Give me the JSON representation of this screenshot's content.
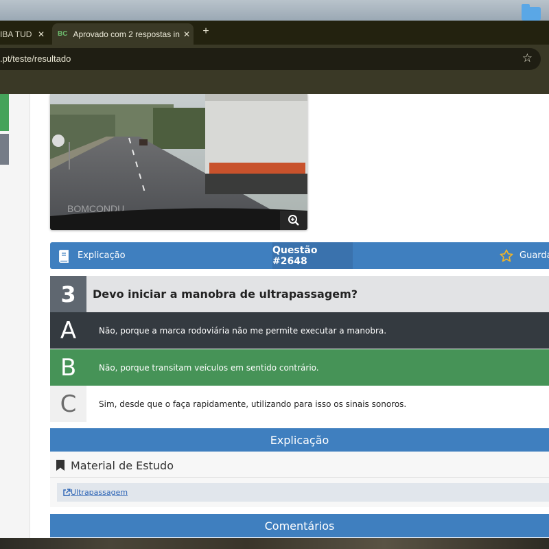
{
  "browser": {
    "tabs": [
      {
        "title": "IBA TUD",
        "active": false
      },
      {
        "title": "Aprovado com 2 respostas in",
        "favicon": "BC",
        "active": true
      }
    ],
    "url": ".pt/teste/resultado"
  },
  "question": {
    "image_watermark": "BOMCONDU",
    "number": "3",
    "id_label": "Questão #2648",
    "explain_label": "Explicação",
    "save_label": "Guarda",
    "text": "Devo iniciar a manobra de ultrapassagem?",
    "answers": [
      {
        "letter": "A",
        "text": "Não, porque a marca rodoviária não me permite executar a manobra.",
        "state": "selected-wrong"
      },
      {
        "letter": "B",
        "text": "Não, porque transitam veículos em sentido contrário.",
        "state": "correct"
      },
      {
        "letter": "C",
        "text": "Sim, desde que o faça rapidamente, utilizando para isso os sinais sonoros.",
        "state": "neutral"
      }
    ]
  },
  "explanation": {
    "header": "Explicação",
    "material_title": "Material de Estudo",
    "link_text": "Ultrapassagem"
  },
  "comments": {
    "header": "Comentários"
  },
  "colors": {
    "primary": "#3f7fbf",
    "correct": "#469357",
    "selected": "#343a40",
    "star": "#f0b429"
  },
  "icons": [
    "close-icon",
    "plus-icon",
    "star-icon",
    "zoom-icon",
    "book-icon",
    "star-outline-icon",
    "bookmark-icon",
    "external-link-icon",
    "folder-icon"
  ]
}
